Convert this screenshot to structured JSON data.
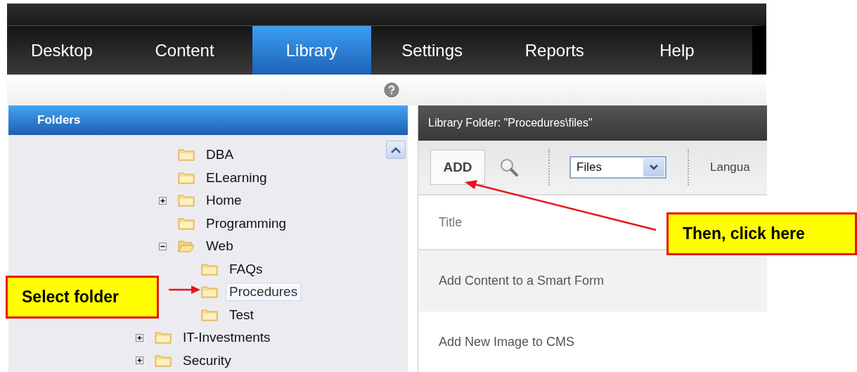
{
  "nav_tabs": [
    {
      "label": "Desktop",
      "selected": false
    },
    {
      "label": "Content",
      "selected": false
    },
    {
      "label": "Library",
      "selected": true
    },
    {
      "label": "Settings",
      "selected": false
    },
    {
      "label": "Reports",
      "selected": false
    },
    {
      "label": "Help",
      "selected": false
    }
  ],
  "folders_panel": {
    "title": "Folders",
    "tree": [
      {
        "children": [
          {
            "label": "DBA",
            "selected": false
          },
          {
            "label": "ELearning",
            "selected": false
          },
          {
            "label": "Home",
            "expanded": false,
            "selected": false
          },
          {
            "label": "Programming",
            "selected": false
          },
          {
            "label": "Web",
            "expanded": true,
            "selected": false,
            "children": [
              {
                "label": "FAQs",
                "selected": false
              },
              {
                "label": "Procedures",
                "selected": true
              },
              {
                "label": "Test",
                "selected": false
              }
            ]
          }
        ]
      },
      {
        "label": "IT-Investments",
        "expanded": false,
        "selected": false
      },
      {
        "label": "Security",
        "expanded": false,
        "selected": false
      }
    ]
  },
  "library_panel": {
    "title": "Library Folder: \"Procedures\\files\"",
    "add_button": "ADD",
    "view_select": "Files",
    "language_label": "Langua",
    "column_header": "Title",
    "rows": [
      "Add Content to a Smart Form",
      "Add New Image to CMS"
    ]
  },
  "annotations": [
    {
      "text": "Select folder"
    },
    {
      "text": "Then, click here"
    }
  ]
}
